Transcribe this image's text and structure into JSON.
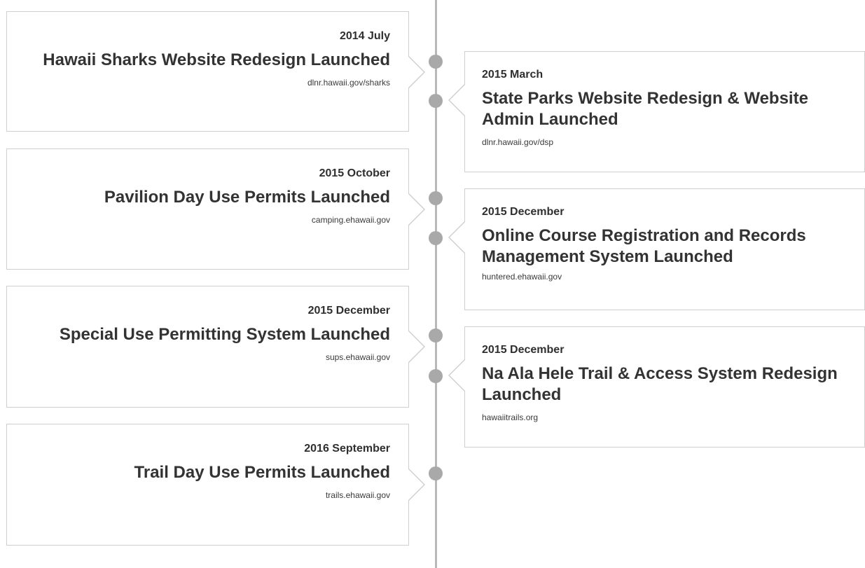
{
  "timeline": {
    "left": [
      {
        "date": "2014 July",
        "title": "Hawaii Sharks Website Redesign Launched",
        "url": "dlnr.hawaii.gov/sharks"
      },
      {
        "date": "2015 October",
        "title": "Pavilion Day Use Permits Launched",
        "url": "camping.ehawaii.gov"
      },
      {
        "date": "2015 December",
        "title": "Special Use Permitting System Launched",
        "url": "sups.ehawaii.gov"
      },
      {
        "date": "2016 September",
        "title": "Trail Day Use Permits Launched",
        "url": "trails.ehawaii.gov"
      }
    ],
    "right": [
      {
        "date": "2015 March",
        "title": "State Parks Website Redesign & Website Admin Launched",
        "url": "dlnr.hawaii.gov/dsp"
      },
      {
        "date": "2015 December",
        "title": "Online Course Registration and Records Management System Launched",
        "url": "huntered.ehawaii.gov"
      },
      {
        "date": "2015 December",
        "title": "Na Ala Hele Trail & Access System Redesign Launched",
        "url": "hawaiitrails.org"
      }
    ]
  }
}
